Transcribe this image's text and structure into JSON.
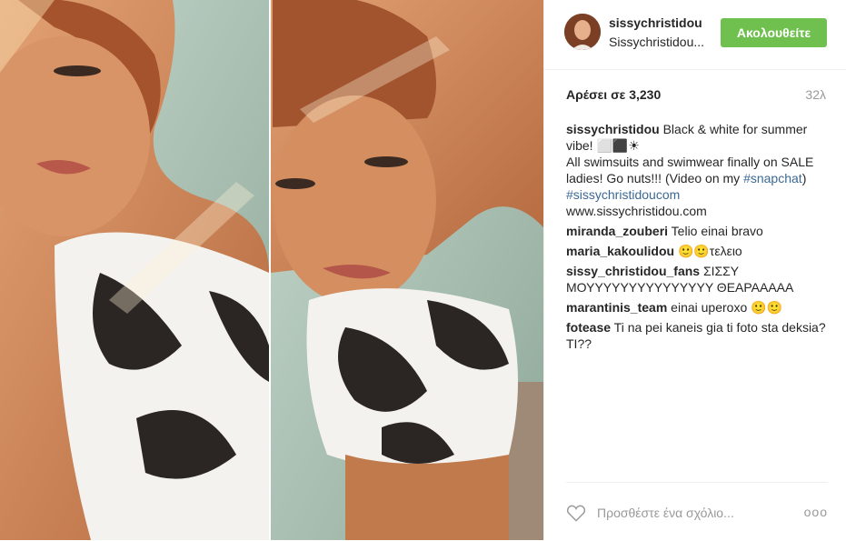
{
  "header": {
    "username": "sissychristidou",
    "subtitle": "Sissychristidou...",
    "follow_label": "Ακολουθείτε"
  },
  "post": {
    "likes": "Αρέσει σε 3,230",
    "age": "32λ"
  },
  "caption": {
    "user": "sissychristidou",
    "line1": "Black & white for summer vibe! ⬜⬛☀",
    "line2": "All swimsuits and swimwear finally on SALE ladies! Go nuts!!! (Video on my ",
    "hashtag1": "#snapchat",
    "line2_end": ")",
    "hashtag2": "#sissychristidoucom",
    "line3": "www.sissychristidou.com"
  },
  "comments": [
    {
      "user": "miranda_zouberi",
      "text": "Telio einai bravo"
    },
    {
      "user": "maria_kakoulidou",
      "text": "🙂🙂τελειο"
    },
    {
      "user": "sissy_christidou_fans",
      "text": "ΣΙΣΣΥ ΜΟΥΥΥΥΥΥΥΥΥΥΥΥΥΥΥ ΘΕΑΡΑΑΑΑΑ"
    },
    {
      "user": "marantinis_team",
      "text": "einai uperoxo 🙂🙂"
    },
    {
      "user": "fotease",
      "text": "Ti na pei kaneis gia ti foto sta deksia? TI??"
    }
  ],
  "footer": {
    "add_comment_placeholder": "Προσθέστε ένα σχόλιο...",
    "more_label": "ooo"
  },
  "icons": {
    "heart": "heart-icon",
    "more": "more-options-icon"
  },
  "colors": {
    "follow_button": "#70c050",
    "link": "#3b6994"
  }
}
